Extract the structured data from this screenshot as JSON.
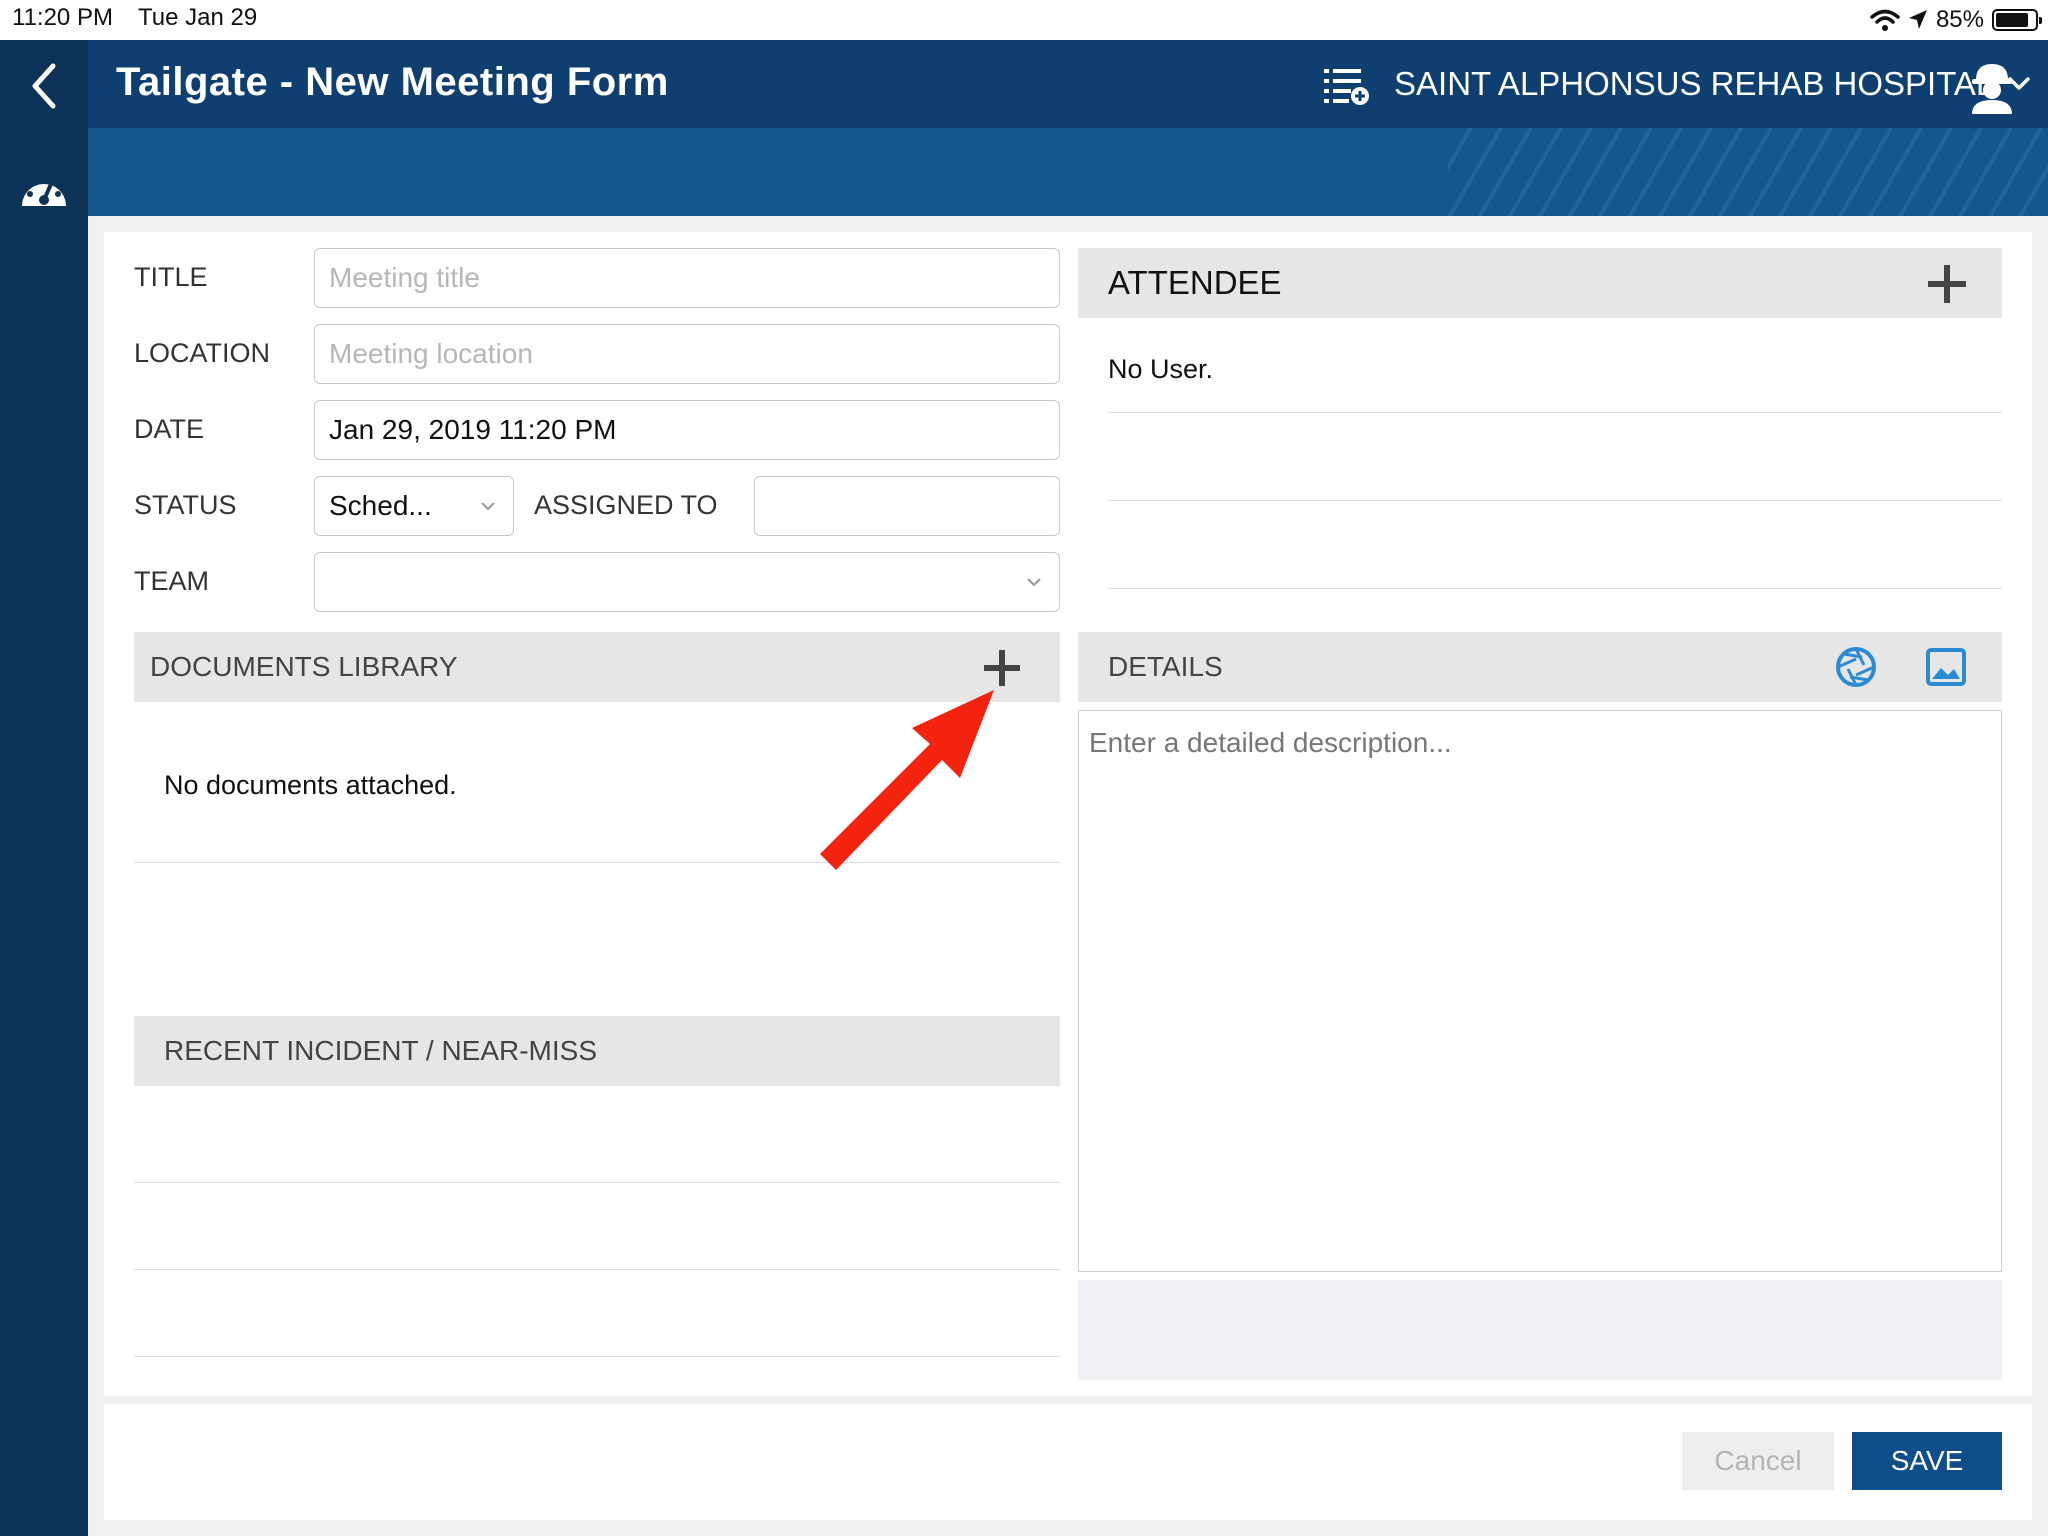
{
  "status_bar": {
    "time": "11:20 PM",
    "date": "Tue Jan 29",
    "battery": "85%"
  },
  "header": {
    "title": "Tailgate - New Meeting Form",
    "organization": "SAINT ALPHONSUS REHAB HOSPITAL"
  },
  "form": {
    "title_label": "TITLE",
    "title_placeholder": "Meeting title",
    "location_label": "LOCATION",
    "location_placeholder": "Meeting location",
    "date_label": "DATE",
    "date_value": "Jan 29, 2019 11:20 PM",
    "status_label": "STATUS",
    "status_value": "Sched...",
    "assigned_to_label": "ASSIGNED TO",
    "assigned_to_value": "",
    "team_label": "TEAM",
    "team_value": ""
  },
  "documents": {
    "header": "DOCUMENTS LIBRARY",
    "empty_text": "No documents attached."
  },
  "incidents": {
    "header": "RECENT INCIDENT / NEAR-MISS"
  },
  "attendee": {
    "header": "ATTENDEE",
    "empty_text": "No User."
  },
  "details": {
    "header": "DETAILS",
    "placeholder": "Enter a detailed description..."
  },
  "footer": {
    "cancel_label": "Cancel",
    "save_label": "SAVE"
  },
  "colors": {
    "nav_dark": "#0d3257",
    "header_blue": "#0f3f70",
    "subheader_blue": "#14578e",
    "accent_blue": "#2a8ad4",
    "save_blue": "#0f4e8a",
    "annotation_red": "#f2230f"
  },
  "icons": {
    "back": "chevron-left-icon",
    "dashboard": "speedometer-icon",
    "list_add": "list-add-icon",
    "org_dropdown": "chevron-down-icon",
    "user": "hardhat-worker-icon",
    "camera": "camera-shutter-icon",
    "image": "image-gallery-icon",
    "add": "plus-icon"
  }
}
